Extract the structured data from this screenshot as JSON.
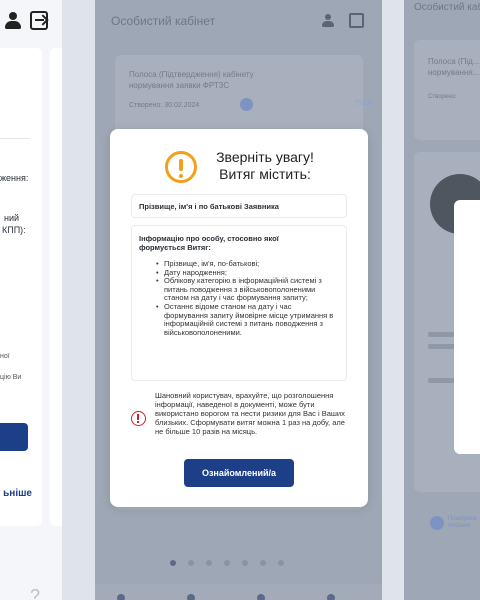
{
  "left_screen": {
    "texts": [
      "ження:",
      "ний",
      "КПП):",
      "ної",
      "цію Ви"
    ],
    "link_label": "ьніше",
    "help_glyph": "?"
  },
  "center_screen": {
    "header_title": "Особистий кабінет",
    "card_title": "Полоса (Підтвердження) кабінету нормування заявки ФРТЗС",
    "card_date": "Створено: 30.02.2024",
    "side_label": "Поши"
  },
  "right_screen": {
    "title": "Особистий кабінет",
    "card_title": "Полоса (Під... нормування...",
    "card_date": "Створено:",
    "footer_text": "Поширене питання"
  },
  "modal": {
    "title_line1": "Зверніть увагу!",
    "title_line2": "Витяг містить:",
    "field1": "Прізвище, ім'я і по батькові Заявника",
    "info_title": "Інформацію про особу, стосовно якої формується Витяг:",
    "info_items": [
      "Прізвище, ім'я, по-батькові;",
      "Дату народження;",
      "Облікову категорію в інформаційній системі з питань поводження з військовополоненими станом на дату і час формування запиту;",
      "Останнє відоме станом на дату і час формування запиту ймовірне місце утримання в інформаційній системі з питань поводження з військовополоненими."
    ],
    "warning_text": "Шановний користувач, врахуйте, що розголошення інформації, наведеної в документі, може бути використано ворогом та нести ризики для Вас і Ваших близьких. Сформувати витяг можна 1 раз на добу, але не більше 10 разів на місяць.",
    "ok_button": "Ознайомлений/а"
  },
  "icons": {
    "user": "user-icon",
    "exit": "exit-icon",
    "warning": "warning-circle-icon",
    "alert": "alert-circle-icon"
  },
  "colors": {
    "accent": "#1d3f87",
    "warning": "#f2a01c",
    "alert": "#c0262c",
    "overlay": "#9ea7b5"
  }
}
